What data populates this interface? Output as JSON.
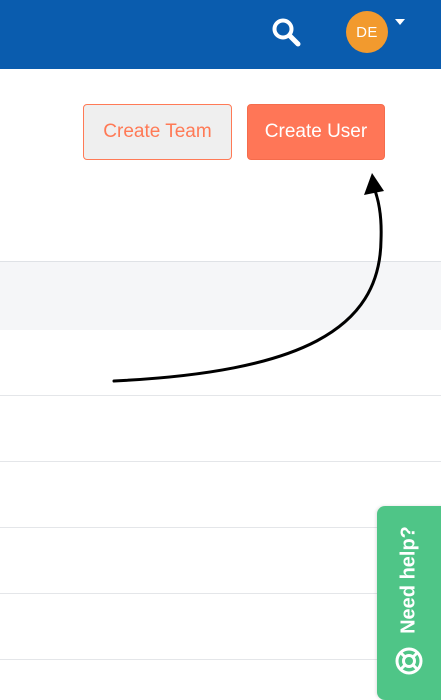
{
  "header": {
    "avatar_initials": "DE",
    "icons": [
      "search-icon",
      "chevron-down-icon"
    ]
  },
  "actions": {
    "create_team_label": "Create Team",
    "create_user_label": "Create User"
  },
  "help": {
    "label": "Need help?",
    "icon": "lifebuoy-icon"
  },
  "colors": {
    "header_bg": "#0a5cae",
    "avatar_bg": "#f29a2e",
    "accent": "#ff7657",
    "help_bg": "#4fc587"
  }
}
